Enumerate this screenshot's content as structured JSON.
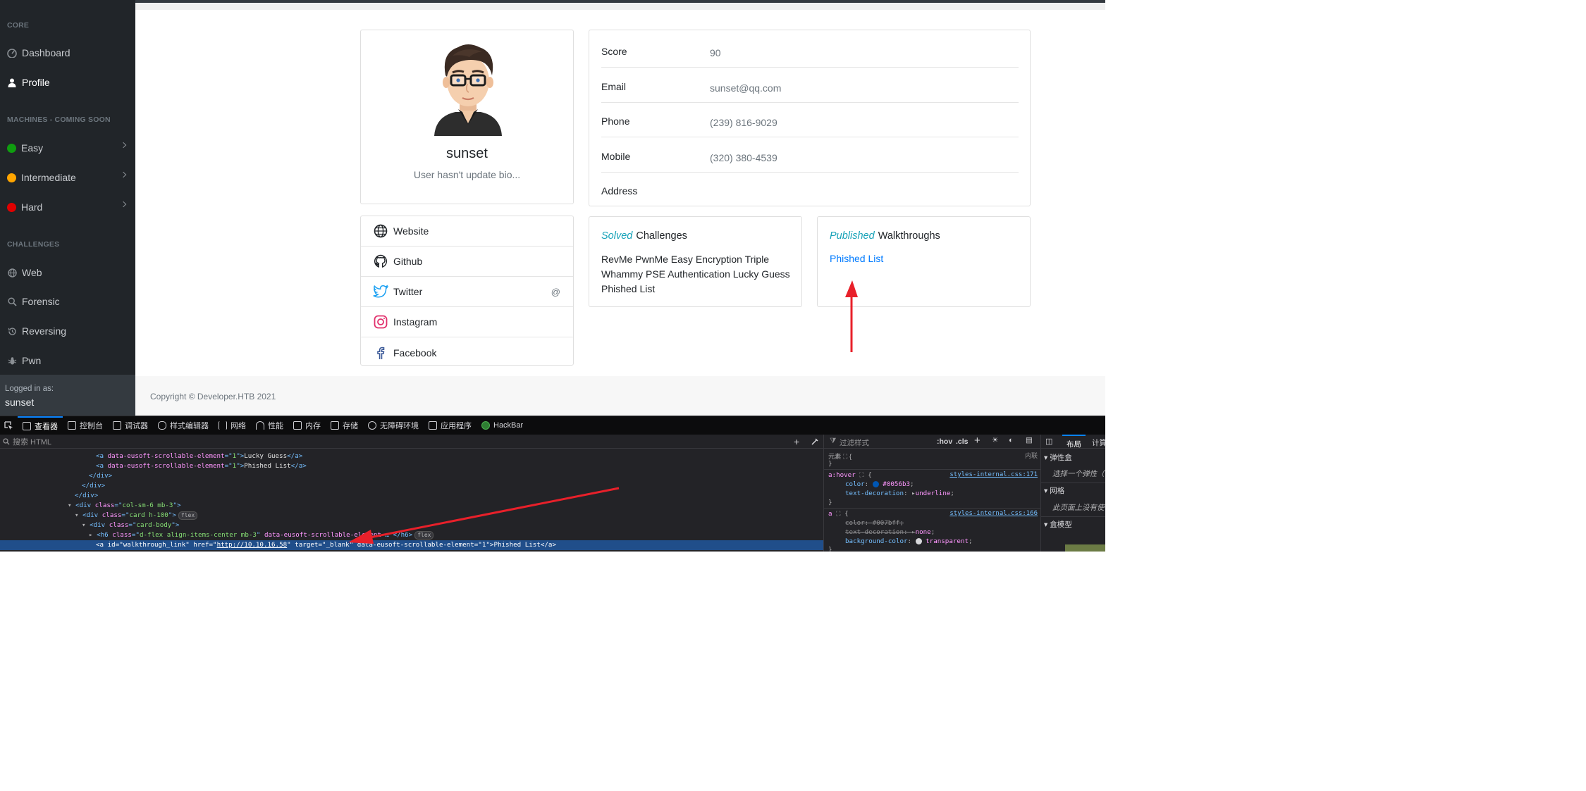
{
  "sidebar": {
    "section_core": "CORE",
    "dashboard": "Dashboard",
    "profile": "Profile",
    "section_machines": "MACHINES - COMING SOON",
    "easy": "Easy",
    "intermediate": "Intermediate",
    "hard": "Hard",
    "section_challenges": "CHALLENGES",
    "web": "Web",
    "forensic": "Forensic",
    "reversing": "Reversing",
    "pwn": "Pwn",
    "logged_in_label": "Logged in as:",
    "logged_in_user": "sunset",
    "colors": {
      "easy": "#0f9d0f",
      "intermediate": "#ffa500",
      "hard": "#e00000"
    }
  },
  "profile": {
    "name": "sunset",
    "bio": "User hasn't update bio..."
  },
  "info": {
    "score_label": "Score",
    "score": "90",
    "email_label": "Email",
    "email": "sunset@qq.com",
    "phone_label": "Phone",
    "phone": "(239) 816-9029",
    "mobile_label": "Mobile",
    "mobile": "(320) 380-4539",
    "address_label": "Address"
  },
  "social": {
    "website": "Website",
    "github": "Github",
    "twitter": "Twitter",
    "twitter_value": "@",
    "instagram": "Instagram",
    "facebook": "Facebook"
  },
  "solved": {
    "tag": "Solved",
    "title": "Challenges",
    "list": "RevMe PwnMe Easy Encryption Triple Whammy PSE Authentication Lucky Guess Phished List"
  },
  "walkthroughs": {
    "tag": "Published",
    "title": "Walkthroughs",
    "link": "Phished List"
  },
  "footer": {
    "copyright": "Copyright © Developer.HTB 2021"
  },
  "devtools": {
    "tabs": [
      "查看器",
      "控制台",
      "调试器",
      "样式编辑器",
      "网络",
      "性能",
      "内存",
      "存储",
      "无障碍环境",
      "应用程序",
      "HackBar"
    ],
    "search_placeholder": "搜索 HTML",
    "styles_filter": "过滤样式",
    "hov": ":hov",
    "cls": ".cls",
    "layout_tab": "布局",
    "compute_tab": "计算",
    "flexbox_label": "弹性盒",
    "flexbox_hint": "选择一个弹性（",
    "grid_label": "网格",
    "grid_hint": "此页面上没有使",
    "boxmodel_label": "盒模型",
    "element_label": "元素",
    "inline_label": "内联",
    "tree": {
      "l1_text": "Lucky Guess",
      "l2_text": "Phished List",
      "div_close": "</div>",
      "col_class": "col-sm-6 mb-3",
      "card_class": "card h-100",
      "body_class": "card-body",
      "h6_class": "d-flex align-items-center mb-3",
      "flex": "flex",
      "a_id": "walkthrough_link",
      "a_href": "http://10.10.16.58",
      "a_target": "_blank",
      "a_text": "Phished List",
      "attr_name": "data-eusoft-scrollable-element",
      "attr_val": "1"
    },
    "rules": {
      "element_brace": "{",
      "close_brace": "}",
      "r1_selector": "a:hover",
      "r1_color": "#0056b3",
      "r1_deco": "underline",
      "r1_link": "styles-internal.css:171",
      "r2_selector": "a",
      "r2_color": "#007bff",
      "r2_deco": "none",
      "r2_bg": "transparent",
      "r2_link": "styles-internal.css:166"
    }
  }
}
